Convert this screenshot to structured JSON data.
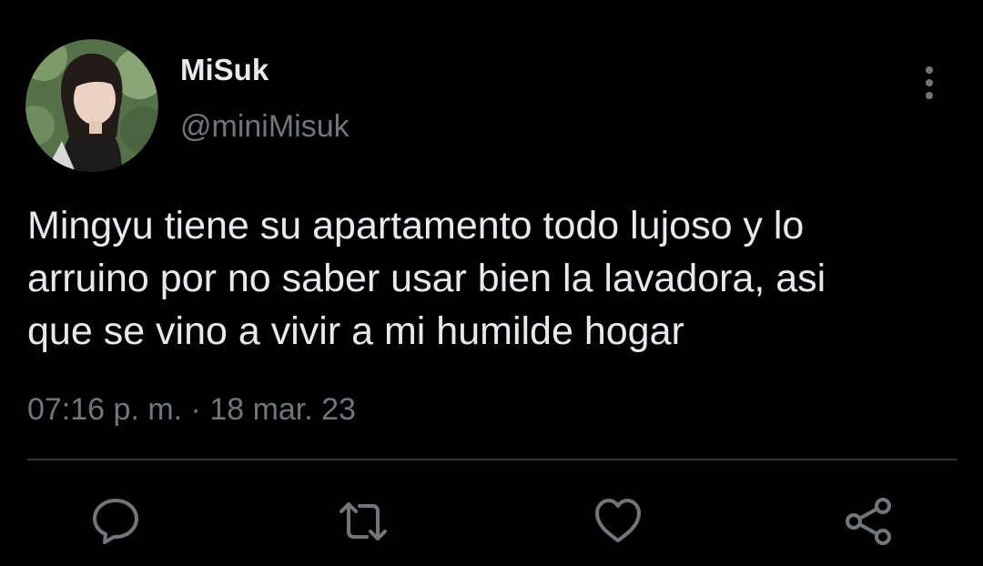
{
  "tweet": {
    "author": {
      "display_name": "MiSuk",
      "handle": "@miniMisuk",
      "avatar_icon": "profile-photo"
    },
    "menu_icon": "vertical-ellipsis-icon",
    "text_lines": [
      "Mingyu tiene su apartamento todo lujoso y lo",
      "arruino por no saber usar bien la lavadora, asi",
      "que se vino a vivir a mi humilde hogar"
    ],
    "meta": "07:16 p. m. · 18 mar. 23",
    "actions": [
      {
        "name": "reply",
        "icon": "comment-bubble-icon"
      },
      {
        "name": "retweet",
        "icon": "retweet-arrows-icon"
      },
      {
        "name": "like",
        "icon": "heart-icon"
      },
      {
        "name": "share",
        "icon": "share-nodes-icon"
      }
    ],
    "colors": {
      "background": "#000000",
      "primary_text": "#e7e9ea",
      "secondary_text": "#71767b",
      "divider": "#2f3336",
      "icon": "#71767b"
    }
  }
}
